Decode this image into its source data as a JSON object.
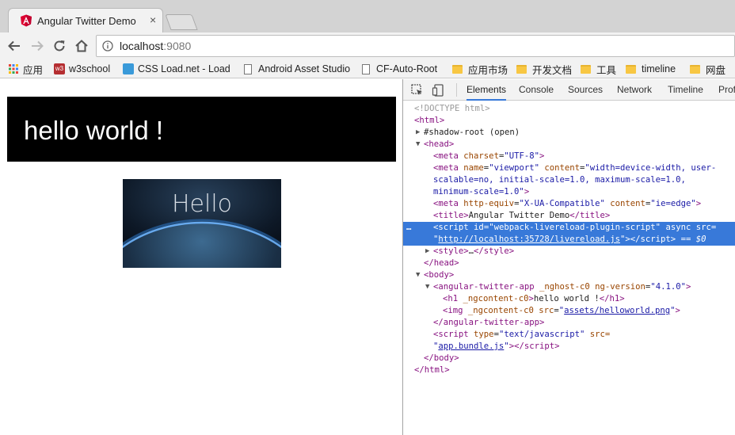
{
  "tab": {
    "title": "Angular Twitter Demo",
    "close": "×"
  },
  "address": {
    "host": "localhost",
    "port": ":9080"
  },
  "bookmarks": [
    "应用",
    "w3school",
    "CSS Load.net - Load",
    "Android Asset Studio",
    "CF-Auto-Root",
    "应用市场",
    "开发文档",
    "工具",
    "timeline",
    "网盘"
  ],
  "page": {
    "heading": "hello world !",
    "hero_text": "Hello"
  },
  "devtools": {
    "tabs": [
      "Elements",
      "Console",
      "Sources",
      "Network",
      "Timeline",
      "Profiles"
    ],
    "active_tab": "Elements",
    "lines": {
      "doctype": "<!DOCTYPE html>",
      "html_open": "<html>",
      "shadow_root": "#shadow-root (open)",
      "head_open": "<head>",
      "meta_charset_tag": "meta",
      "meta_charset_attr": "charset",
      "meta_charset_val": "\"UTF-8\"",
      "meta_vp_attr1": "name",
      "meta_vp_val1": "\"viewport\"",
      "meta_vp_attr2": "content",
      "meta_vp_val2a": "\"width=device-width, user-",
      "meta_vp_val2b": "scalable=no, initial-scale=1.0, maximum-scale=1.0,",
      "meta_vp_val2c": "minimum-scale=1.0\"",
      "meta_xua_attr1": "http-equiv",
      "meta_xua_val1": "\"X-UA-Compatible\"",
      "meta_xua_attr2": "content",
      "meta_xua_val2": "\"ie=edge\"",
      "title_text": "Angular Twitter Demo",
      "script_id_val": "\"webpack-livereload-plugin-script\"",
      "script_async": "async",
      "script_src_attr": "src=",
      "script_src_val": "http://localhost:35728/livereload.js",
      "selected_marker": "== $0",
      "style_collapsed": "…",
      "ng_app_tag": "angular-twitter-app",
      "ng_app_attr1": "_nghost-c0",
      "ng_app_attr2": "ng-version",
      "ng_app_val2": "\"4.1.0\"",
      "h1_attr": "_ngcontent-c0",
      "h1_text": "hello world !",
      "img_attr1": "_ngcontent-c0",
      "img_attr2": "src",
      "img_src": "assets/helloworld.png",
      "bundle_type_attr": "type",
      "bundle_type_val": "\"text/javascript\"",
      "bundle_src_attr": "src=",
      "bundle_src": "app.bundle.js"
    }
  },
  "colors": {
    "selection": "#3879d9",
    "tag": "#881280",
    "attr": "#994500",
    "value": "#1a1aa6"
  }
}
